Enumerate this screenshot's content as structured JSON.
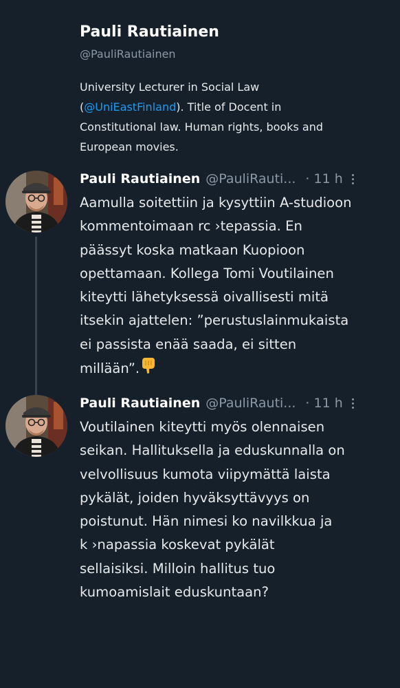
{
  "profile": {
    "name": "Pauli Rautiainen",
    "handle": "@PauliRautiainen",
    "bio_line1": "University Lecturer in Social Law",
    "bio_open_paren": "(",
    "bio_mention": "@UniEastFinland",
    "bio_line2_rest": "). Title of Docent in",
    "bio_line3": "Constitutional law. Human rights, books and",
    "bio_line4": "European movies."
  },
  "tweets": [
    {
      "author": "Pauli Rautiainen",
      "handle": "@PauliRauti...",
      "time": "· 11 h",
      "lines": [
        "Aamulla soitettiin ja kysyttiin A-studioon",
        "kommentoimaan rc   ›tepassia. En",
        "päässyt koska matkaan Kuopioon",
        "opettamaan. Kollega Tomi Voutilainen",
        "kiteytti lähetyksessä oivallisesti mitä",
        "itsekin ajattelen: ”perustuslainmukaista",
        "ei passista enää saada, ei sitten",
        "millään”."
      ],
      "emoji": "backhand-index-pointing-down"
    },
    {
      "author": "Pauli Rautiainen",
      "handle": "@PauliRauti...",
      "time": "· 11 h",
      "lines": [
        "Voutilainen kiteytti myös olennaisen",
        "seikan. Hallituksella ja eduskunnalla on",
        "velvollisuus kumota viipymättä laista",
        "pykälät, joiden hyväksyttävyys on",
        "poistunut. Hän nimesi ko     navilkkua ja",
        "k    ›napassia koskevat pykälät",
        "sellaisiksi. Milloin hallitus tuo",
        "kumoamislait eduskuntaan?"
      ]
    }
  ],
  "colors": {
    "background": "#15202b",
    "text": "#e7e9ea",
    "muted": "#8b98a5",
    "link": "#1d9bf0",
    "thread_line": "#38444d"
  }
}
